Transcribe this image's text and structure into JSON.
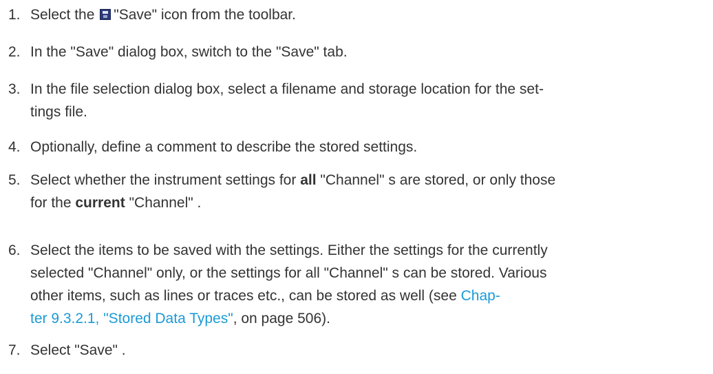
{
  "steps": [
    {
      "number": "1.",
      "before": "Select the",
      "icon": "save-icon",
      "after": "\"Save\" icon from the toolbar."
    },
    {
      "number": "2.",
      "text": "In the \"Save\" dialog box, switch to the \"Save\" tab."
    },
    {
      "number": "3.",
      "line1": "In the file selection dialog box, select a filename and storage location for the set-",
      "line2": "tings file."
    },
    {
      "number": "4.",
      "text": "Optionally, define a comment to describe the stored settings."
    },
    {
      "number": "5.",
      "l1_a": "Select whether the instrument settings for ",
      "l1_bold": "all",
      "l1_b": " \"Channel\" s are stored, or only those",
      "l2_a": "for the ",
      "l2_bold": "current",
      "l2_b": " \"Channel\" ."
    },
    {
      "number": "6.",
      "line1": "Select the items to be saved with the settings. Either the settings for the currently",
      "line2": "selected \"Channel\" only, or the settings for all \"Channel\" s can be stored. Various",
      "line3_text": "other items, such as lines or traces etc., can be stored as well (see ",
      "line3_link": "Chap-",
      "line4_link": "ter 9.3.2.1, \"Stored Data Types\"",
      "line4_text": ", on page 506)."
    },
    {
      "number": "7.",
      "text": "Select \"Save\" ."
    }
  ]
}
